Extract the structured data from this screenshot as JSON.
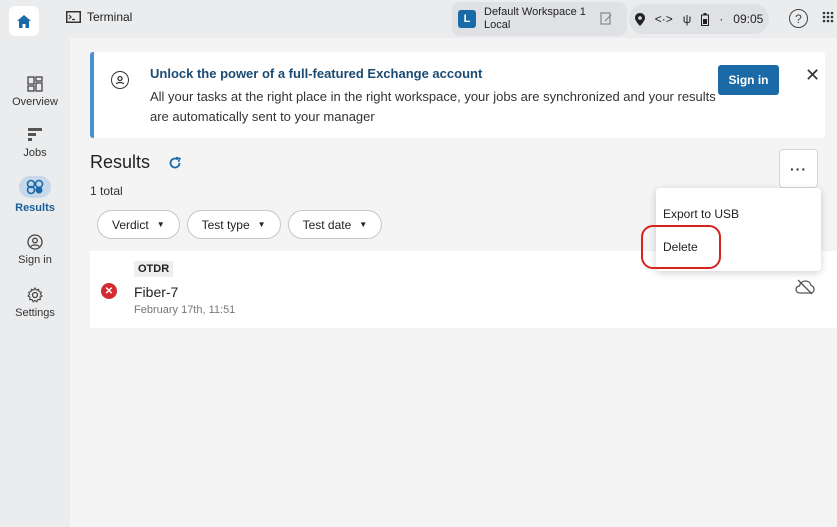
{
  "topbar": {
    "app_name": "Terminal",
    "workspace_badge": "L",
    "workspace_name": "Default Workspace 1",
    "workspace_location": "Local",
    "status_separator": "·",
    "clock": "09:05",
    "help_glyph": "?"
  },
  "sidebar": {
    "items": [
      {
        "label": "Overview",
        "icon": "dashboard-icon"
      },
      {
        "label": "Jobs",
        "icon": "jobs-icon"
      },
      {
        "label": "Results",
        "icon": "results-icon"
      },
      {
        "label": "Sign in",
        "icon": "account-icon"
      },
      {
        "label": "Settings",
        "icon": "gear-icon"
      }
    ],
    "active": "Results"
  },
  "banner": {
    "title": "Unlock the power of a full-featured Exchange account",
    "description": "All your tasks at the right place in the right workspace, your jobs are synchronized and your results are automatically sent to your manager",
    "signin_label": "Sign in",
    "close_glyph": "✕"
  },
  "results": {
    "title": "Results",
    "refresh_glyph": "C",
    "count": "1 total",
    "filters": [
      "Verdict",
      "Test type",
      "Test date"
    ],
    "more_glyph": "···"
  },
  "menu": {
    "items": [
      "Export to USB",
      "Delete"
    ]
  },
  "rows": [
    {
      "type": "OTDR",
      "name": "Fiber-7",
      "date": "February 17th, 11:51",
      "status": "fail",
      "sync": "cloud-off"
    }
  ],
  "colors": {
    "accent": "#1a6aa8",
    "fail": "#d42b33",
    "highlight": "#d6231e"
  }
}
